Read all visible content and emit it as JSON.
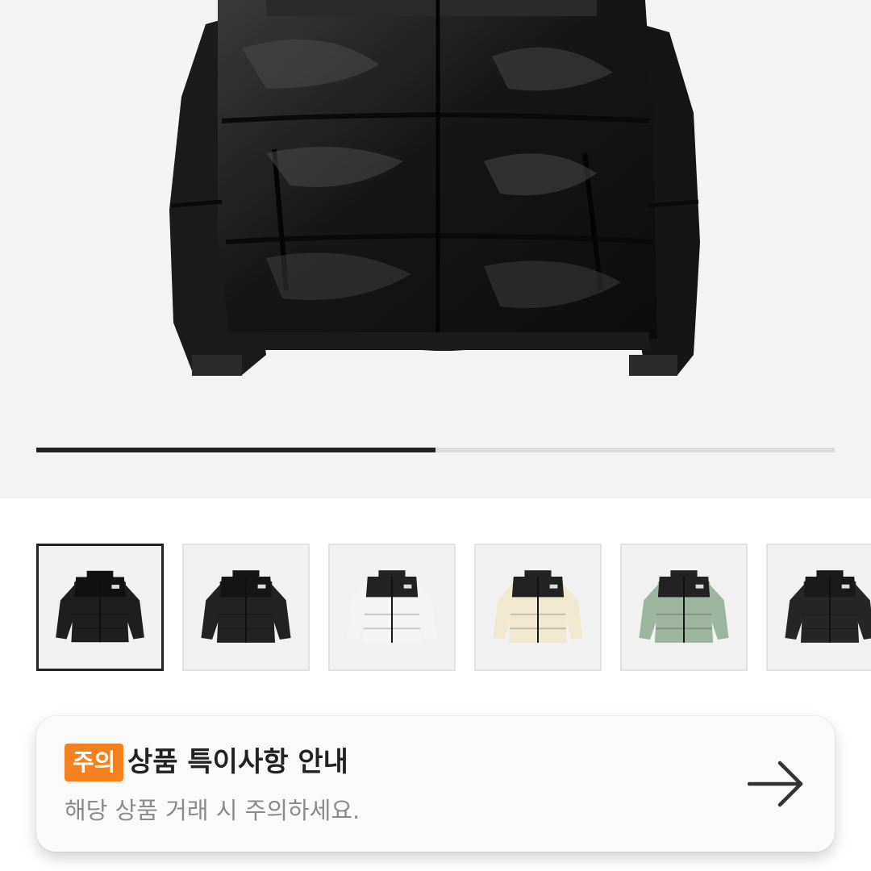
{
  "gallery": {
    "main_image": "black-glossy-puffer-jacket",
    "progress": 0.5,
    "thumbnails": [
      {
        "name": "glossy-black-puffer",
        "body": "#1e1e1e",
        "yoke": "#111111",
        "selected": true
      },
      {
        "name": "black-puffer",
        "body": "#222222",
        "yoke": "#151515",
        "selected": false
      },
      {
        "name": "white-puffer",
        "body": "#f4f4f4",
        "yoke": "#222222",
        "selected": false
      },
      {
        "name": "cream-puffer",
        "body": "#f0e8cf",
        "yoke": "#222222",
        "selected": false
      },
      {
        "name": "sage-green-puffer",
        "body": "#9cb59f",
        "yoke": "#222222",
        "selected": false
      },
      {
        "name": "matte-black-puffer",
        "body": "#262626",
        "yoke": "#1a1a1a",
        "selected": false
      }
    ]
  },
  "notice": {
    "badge": "주의",
    "title": "상품 특이사항 안내",
    "subtitle": "해당 상품 거래 시 주의하세요.",
    "action_icon": "arrow-right-icon",
    "badge_color": "#f5801f"
  }
}
